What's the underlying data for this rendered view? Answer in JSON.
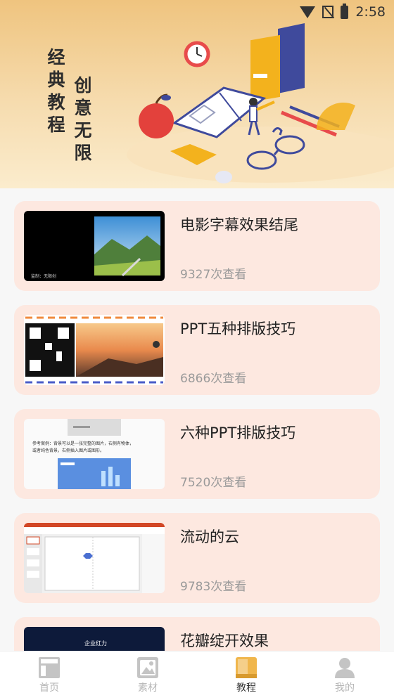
{
  "status_bar": {
    "time": "2:58"
  },
  "banner": {
    "line1": "经典教程",
    "line2": "创意无限"
  },
  "tutorials": [
    {
      "title": "电影字幕效果结尾",
      "views": "9327次查看",
      "thumb": "movie"
    },
    {
      "title": "PPT五种排版技巧",
      "views": "6866次查看",
      "thumb": "qr"
    },
    {
      "title": "六种PPT排版技巧",
      "views": "7520次查看",
      "thumb": "doc"
    },
    {
      "title": "流动的云",
      "views": "9783次查看",
      "thumb": "editor"
    },
    {
      "title": "花瓣绽开效果",
      "views": "",
      "thumb": "dark"
    }
  ],
  "thumb_text": {
    "movie_caption": "监制：无限创",
    "doc_line1": "参考案例：背景可以是一张完整的图片，右侧有物体，",
    "doc_line2": "或者纯色背景，右侧插入图片或图形。",
    "dark_title": "企业红力"
  },
  "nav": [
    {
      "label": "首页",
      "icon": "home-icon",
      "active": false
    },
    {
      "label": "素材",
      "icon": "image-icon",
      "active": false
    },
    {
      "label": "教程",
      "icon": "book-icon",
      "active": true
    },
    {
      "label": "我的",
      "icon": "user-icon",
      "active": false
    }
  ],
  "colors": {
    "card_bg": "#fde8e0",
    "active_nav": "#f0b64c",
    "inactive_nav": "#c4c4c4"
  }
}
